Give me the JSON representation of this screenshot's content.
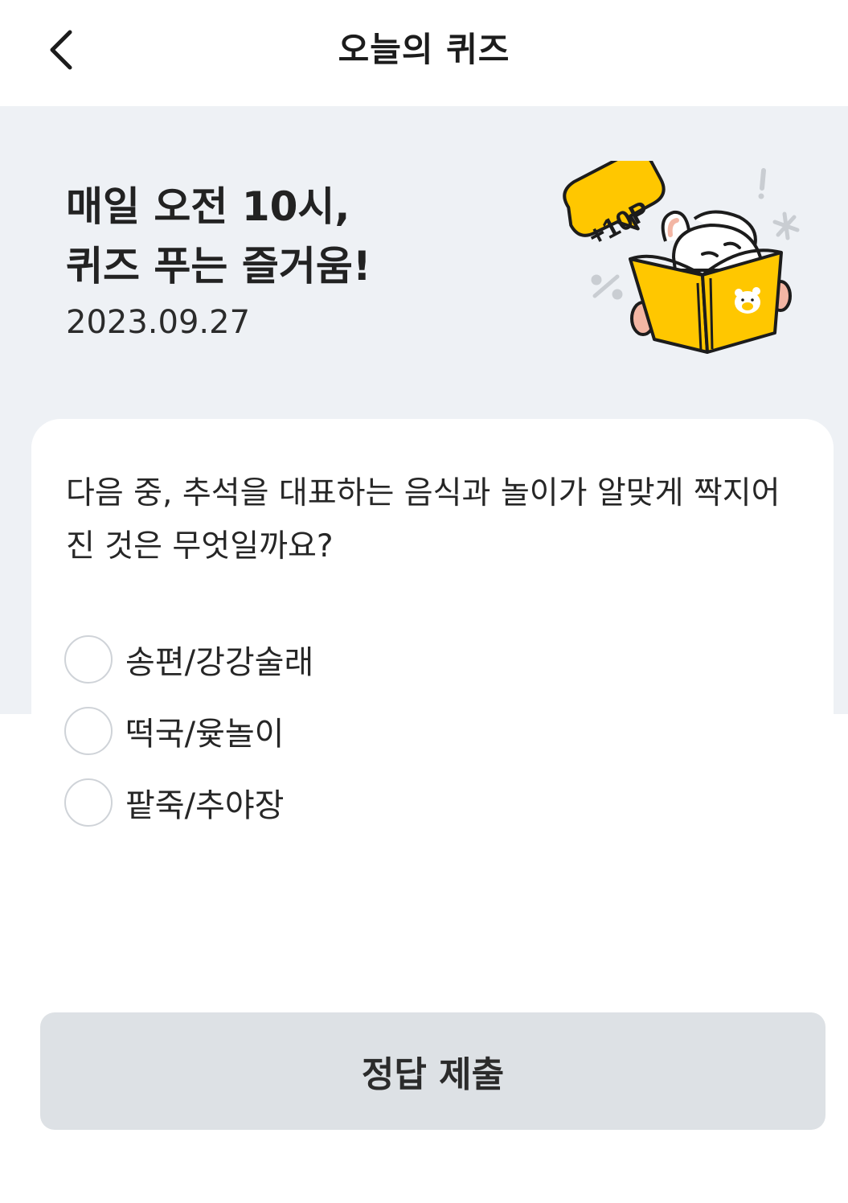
{
  "header": {
    "title": "오늘의 퀴즈",
    "back_icon": "chevron-left-icon"
  },
  "hero": {
    "title": "매일 오전 10시,\n퀴즈 푸는 즐거움!",
    "date": "2023.09.27",
    "badge": "+10P",
    "accent_color": "#ffc700"
  },
  "quiz": {
    "question": "다음 중, 추석을 대표하는 음식과 놀이가 알맞게 짝지어 진 것은 무엇일까요?",
    "options": [
      {
        "label": "송편/강강술래",
        "selected": false
      },
      {
        "label": "떡국/윷놀이",
        "selected": false
      },
      {
        "label": "팥죽/추야장",
        "selected": false
      }
    ]
  },
  "submit": {
    "label": "정답 제출",
    "enabled": false
  },
  "colors": {
    "hero_bg": "#eef1f5",
    "button_bg": "#dde1e5",
    "radio_border": "#cfd3d8"
  }
}
